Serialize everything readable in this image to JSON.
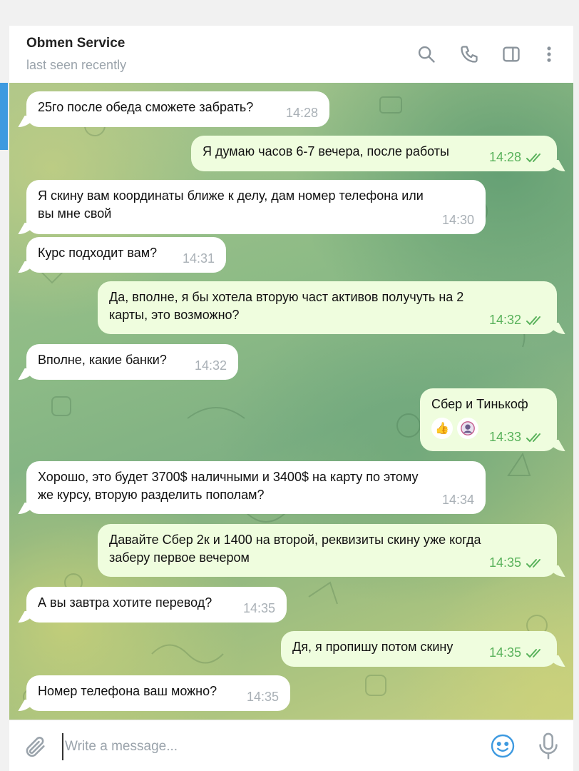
{
  "header": {
    "title": "Obmen Service",
    "status": "last seen recently",
    "icons": [
      "search-icon",
      "phone-icon",
      "sidebar-toggle-icon",
      "more-vertical-icon"
    ]
  },
  "colors": {
    "incoming_bubble": "#ffffff",
    "outgoing_bubble": "#effdde",
    "read_ticks": "#59b25b",
    "accent": "#3e9ae0"
  },
  "messages": [
    {
      "dir": "in",
      "text": "25го после обеда сможете забрать?",
      "time": "14:28"
    },
    {
      "dir": "out",
      "text": "Я думаю часов 6-7 вечера, после работы",
      "time": "14:28",
      "read": true
    },
    {
      "dir": "in",
      "text": "Я скину вам координаты ближе к делу, дам номер телефона или\nвы мне свой",
      "time": "14:30"
    },
    {
      "dir": "in",
      "text": "Курс подходит вам?",
      "time": "14:31"
    },
    {
      "dir": "out",
      "text": "Да, вполне, я бы хотела вторую част активов получуть на 2\nкарты, это возможно?",
      "time": "14:32",
      "read": true
    },
    {
      "dir": "in",
      "text": "Вполне, какие банки?",
      "time": "14:32"
    },
    {
      "dir": "out",
      "text": "Сбер и Тинькоф",
      "time": "14:33",
      "read": true,
      "reactions": [
        "👍",
        "avatar"
      ]
    },
    {
      "dir": "in",
      "text": "Хорошо, это будет 3700$ наличными и 3400$ на карту по этому\nже курсу, вторую разделить пополам?",
      "time": "14:34"
    },
    {
      "dir": "out",
      "text": "Давайте Сбер 2к и 1400 на второй, реквизиты скину уже когда\nзаберу первое вечером",
      "time": "14:35",
      "read": true
    },
    {
      "dir": "in",
      "text": "А вы завтра хотите перевод?",
      "time": "14:35"
    },
    {
      "dir": "out",
      "text": "Дя, я пропишу потом скину",
      "time": "14:35",
      "read": true
    },
    {
      "dir": "in",
      "text": "Номер телефона ваш можно?",
      "time": "14:35"
    }
  ],
  "composer": {
    "placeholder": "Write a message...",
    "icons": [
      "paperclip-icon",
      "emoji-icon",
      "microphone-icon"
    ]
  }
}
